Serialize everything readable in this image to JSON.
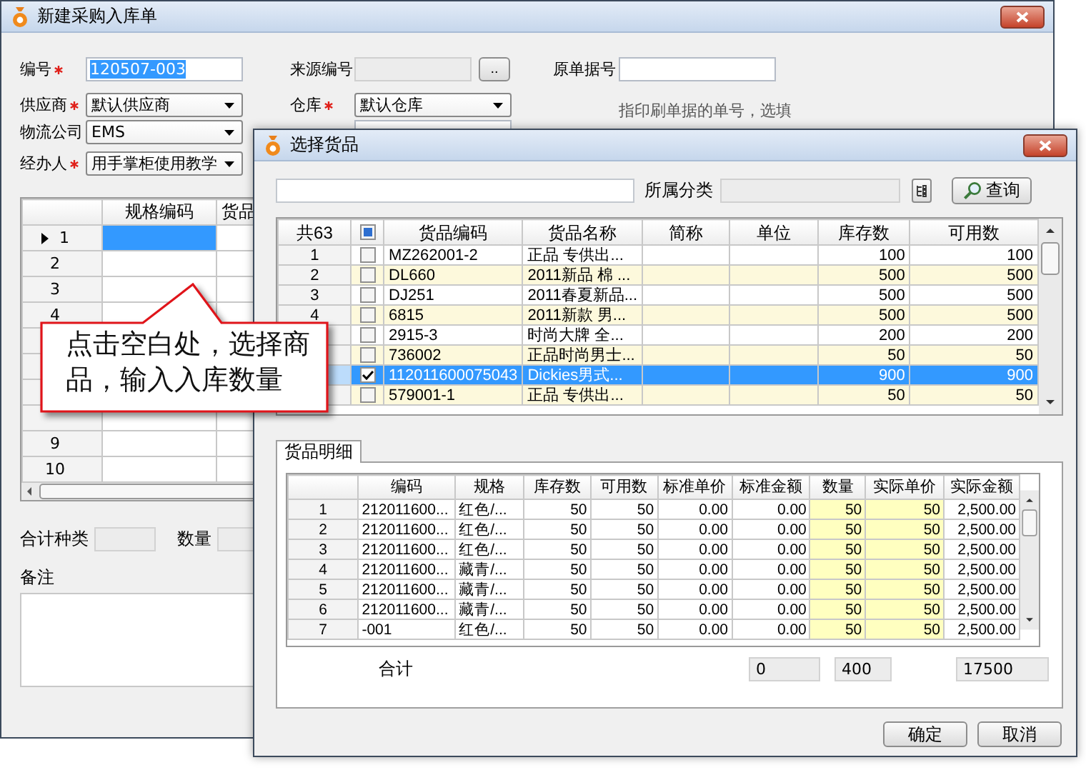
{
  "main_window": {
    "title": "新建采购入库单",
    "form_rows": [
      [
        {
          "kind": "text",
          "label": "编号",
          "required": true,
          "value": "120507-003",
          "text_selected": true,
          "disabled": false
        },
        {
          "kind": "text",
          "label": "来源编号",
          "required": false,
          "disabled": true,
          "button": ".."
        },
        {
          "kind": "text",
          "label": "原单据号",
          "required": false,
          "disabled": false
        }
      ],
      [
        {
          "kind": "select",
          "label": "供应商",
          "required": true,
          "value": "默认供应商"
        },
        {
          "kind": "select",
          "label": "仓库",
          "required": true,
          "value": "默认仓库"
        },
        {
          "kind": "note",
          "text": "指印刷单据的单号，选填"
        }
      ],
      [
        {
          "kind": "select",
          "label": "物流公司",
          "required": false,
          "value": "EMS"
        },
        {
          "kind": "text",
          "disabled": false
        }
      ],
      [
        {
          "kind": "select",
          "label": "经办人",
          "required": true,
          "value": "用手掌柜使用教学"
        }
      ]
    ],
    "grid": {
      "columns": [
        "规格编码",
        "货品"
      ],
      "rows": [
        {
          "kind": "numbered",
          "label": "1",
          "selected": true
        },
        {
          "kind": "numbered",
          "label": "2",
          "selected": false
        },
        {
          "kind": "numbered",
          "label": "3",
          "selected": false
        },
        {
          "kind": "numbered",
          "label": "4",
          "selected": false
        },
        {
          "kind": "blank"
        },
        {
          "kind": "blank"
        },
        {
          "kind": "blank"
        },
        {
          "kind": "blank"
        },
        {
          "kind": "numbered",
          "label": "9",
          "selected": false
        },
        {
          "kind": "numbered",
          "label": "10",
          "selected": false
        }
      ]
    },
    "summary": [
      {
        "label": "合计种类"
      },
      {
        "label": "数量"
      }
    ],
    "notes": {
      "label": "备注"
    }
  },
  "dialog": {
    "title": "选择货品",
    "category": {
      "label": "所属分类"
    },
    "query_button": "查询",
    "goods": {
      "count": "共63",
      "select_all_partial": true,
      "columns": [
        "货品编码",
        "货品名称",
        "简称",
        "单位",
        "库存数",
        "可用数"
      ],
      "rows": [
        {
          "index": "1",
          "code": "MZ262001-2",
          "name": "正品 专供出...",
          "stock": "100",
          "available": "100",
          "checked": false,
          "selected": false
        },
        {
          "index": "2",
          "code": "DL660",
          "name": "2011新品 棉 ...",
          "stock": "500",
          "available": "500",
          "checked": false,
          "selected": false
        },
        {
          "index": "3",
          "code": "DJ251",
          "name": "2011春夏新品...",
          "stock": "500",
          "available": "500",
          "checked": false,
          "selected": false
        },
        {
          "index": "4",
          "code": "6815",
          "name": "2011新款 男...",
          "stock": "500",
          "available": "500",
          "checked": false,
          "selected": false
        },
        {
          "code": "2915-3",
          "name": "时尚大牌 全...",
          "stock": "200",
          "available": "200",
          "checked": false,
          "selected": false
        },
        {
          "code": "736002",
          "name": "正品时尚男士...",
          "stock": "50",
          "available": "50",
          "checked": false,
          "selected": false
        },
        {
          "code": "112011600075043",
          "name": "Dickies男式...",
          "stock": "900",
          "available": "900",
          "checked": true,
          "selected": true
        },
        {
          "code": "579001-1",
          "name": "正品 专供出...",
          "stock": "50",
          "available": "50",
          "checked": false,
          "selected": false
        }
      ]
    },
    "tabs": [
      {
        "label": "货品明细",
        "selected": true
      }
    ],
    "detail": {
      "columns": [
        {
          "label": "编码",
          "editable": false
        },
        {
          "label": "规格",
          "editable": false
        },
        {
          "label": "库存数",
          "editable": false
        },
        {
          "label": "可用数",
          "editable": false
        },
        {
          "label": "标准单价",
          "editable": false
        },
        {
          "label": "标准金额",
          "editable": false
        },
        {
          "label": "数量",
          "editable": true
        },
        {
          "label": "实际单价",
          "editable": true
        },
        {
          "label": "实际金额",
          "editable": false
        }
      ],
      "rows": [
        {
          "index": "1",
          "cells": [
            "212011600...",
            "红色/...",
            "50",
            "50",
            "0.00",
            "0.00",
            "50",
            "50",
            "2,500.00"
          ]
        },
        {
          "index": "2",
          "cells": [
            "212011600...",
            "红色/...",
            "50",
            "50",
            "0.00",
            "0.00",
            "50",
            "50",
            "2,500.00"
          ]
        },
        {
          "index": "3",
          "cells": [
            "212011600...",
            "红色/...",
            "50",
            "50",
            "0.00",
            "0.00",
            "50",
            "50",
            "2,500.00"
          ]
        },
        {
          "index": "4",
          "cells": [
            "212011600...",
            "藏青/...",
            "50",
            "50",
            "0.00",
            "0.00",
            "50",
            "50",
            "2,500.00"
          ]
        },
        {
          "index": "5",
          "cells": [
            "212011600...",
            "藏青/...",
            "50",
            "50",
            "0.00",
            "0.00",
            "50",
            "50",
            "2,500.00"
          ]
        },
        {
          "index": "6",
          "cells": [
            "212011600...",
            "藏青/...",
            "50",
            "50",
            "0.00",
            "0.00",
            "50",
            "50",
            "2,500.00"
          ]
        },
        {
          "index": "7",
          "cells": [
            "-001",
            "红色/...",
            "50",
            "50",
            "0.00",
            "0.00",
            "50",
            "50",
            "2,500.00"
          ]
        }
      ]
    },
    "totals": {
      "label": "合计",
      "values": [
        "0",
        "400",
        "17500"
      ]
    },
    "buttons": [
      "确定",
      "取消"
    ]
  },
  "callout": {
    "text": "点击空白处，选择商品，输入入库数量"
  }
}
